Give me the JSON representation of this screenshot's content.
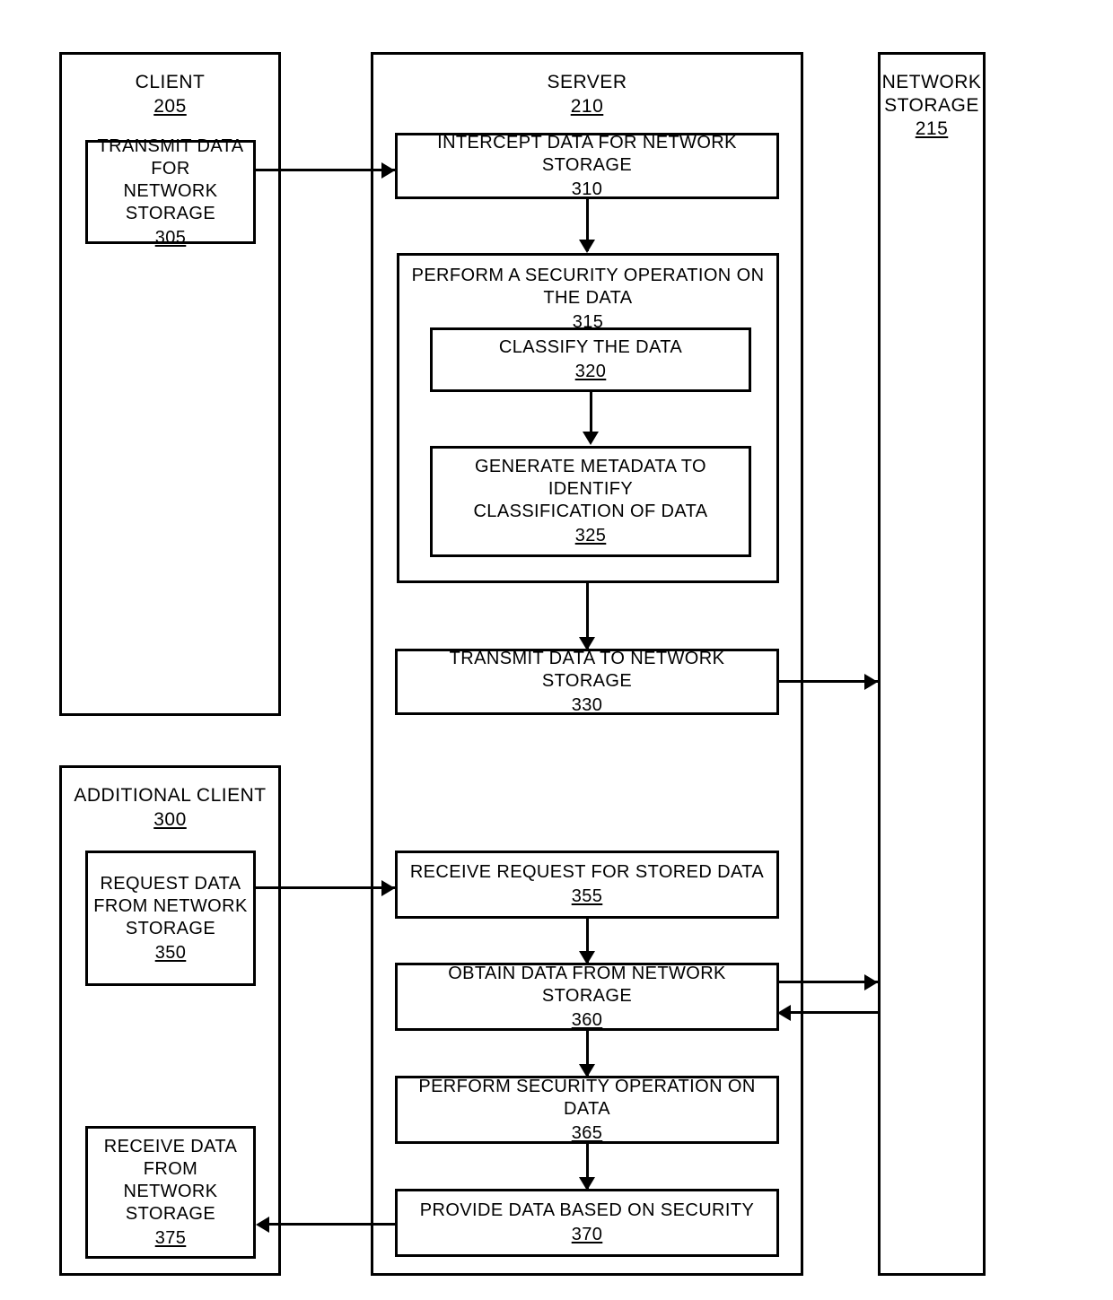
{
  "figure": {
    "type": "patent-flowchart",
    "lanes": [
      {
        "id": "client",
        "title": "CLIENT",
        "ref": "205"
      },
      {
        "id": "server",
        "title": "SERVER",
        "ref": "210"
      },
      {
        "id": "network_storage",
        "title_line1": "NETWORK",
        "title_line2": "STORAGE",
        "ref": "215"
      },
      {
        "id": "additional_client",
        "title": "ADDITIONAL CLIENT",
        "ref": "300"
      }
    ],
    "steps": {
      "s305": {
        "line1": "TRANSMIT DATA FOR",
        "line2": "NETWORK STORAGE",
        "ref": "305"
      },
      "s310": {
        "line1": "INTERCEPT DATA FOR NETWORK STORAGE",
        "ref": "310"
      },
      "s315": {
        "line1": "PERFORM A SECURITY OPERATION ON THE DATA",
        "ref": "315"
      },
      "s320": {
        "line1": "CLASSIFY THE DATA",
        "ref": "320"
      },
      "s325": {
        "line1": "GENERATE METADATA TO IDENTIFY",
        "line2": "CLASSIFICATION OF DATA",
        "ref": "325"
      },
      "s330": {
        "line1": "TRANSMIT DATA TO NETWORK STORAGE",
        "ref": "330"
      },
      "s350": {
        "line1": "REQUEST DATA",
        "line2": "FROM NETWORK",
        "line3": "STORAGE",
        "ref": "350"
      },
      "s355": {
        "line1": "RECEIVE REQUEST FOR STORED DATA",
        "ref": "355"
      },
      "s360": {
        "line1": "OBTAIN DATA FROM NETWORK STORAGE",
        "ref": "360"
      },
      "s365": {
        "line1": "PERFORM SECURITY OPERATION ON DATA",
        "ref": "365"
      },
      "s370": {
        "line1": "PROVIDE DATA BASED ON SECURITY",
        "ref": "370"
      },
      "s375": {
        "line1": "RECEIVE DATA FROM",
        "line2": "NETWORK STORAGE",
        "ref": "375"
      }
    },
    "colors": {
      "stroke": "#000000",
      "background": "#ffffff",
      "text": "#000000"
    }
  }
}
